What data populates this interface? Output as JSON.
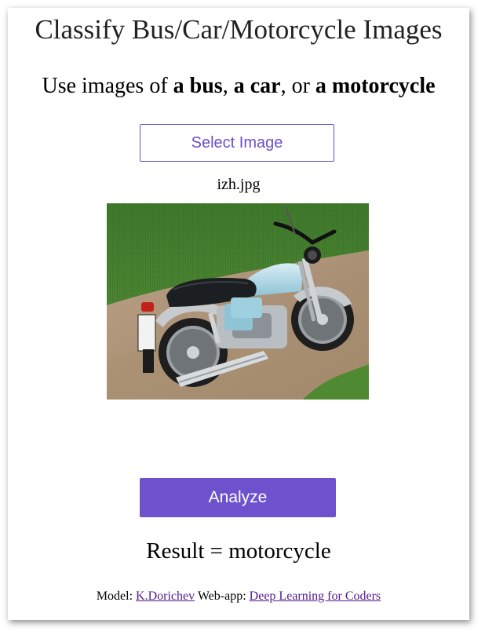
{
  "page": {
    "title": "Classify Bus/Car/Motorcycle Images",
    "subtitle": {
      "prefix": "Use images of ",
      "bus": "a bus",
      "sep1": ", ",
      "car": "a car",
      "sep2": ", or ",
      "motorcycle": "a motorcycle"
    }
  },
  "controls": {
    "select_label": "Select Image",
    "filename": "izh.jpg",
    "analyze_label": "Analyze"
  },
  "result": {
    "text": "Result = motorcycle"
  },
  "footer": {
    "model_prefix": "Model: ",
    "model_link": "K.Dorichev",
    "webapp_prefix": " Web-app: ",
    "webapp_link": "Deep Learning for Coders"
  },
  "colors": {
    "accent": "#6e51cc",
    "link": "#551a8b"
  }
}
